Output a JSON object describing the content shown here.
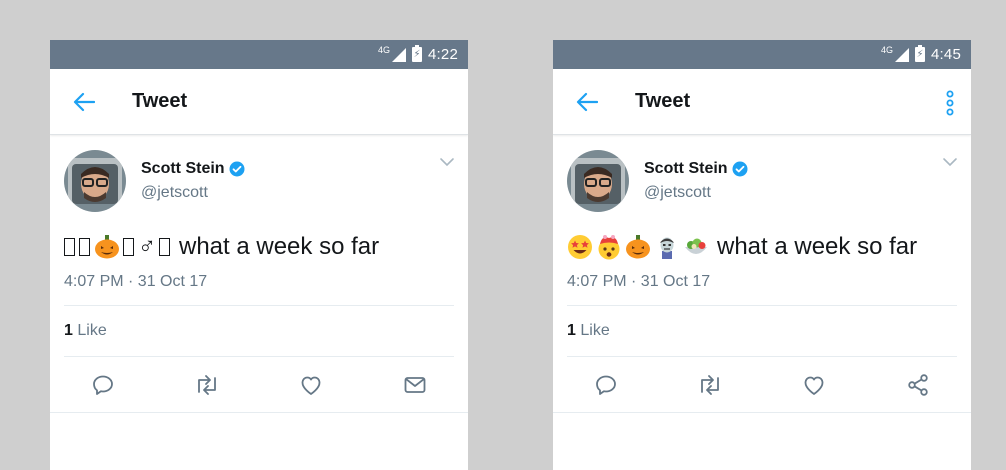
{
  "left": {
    "status_bar": {
      "network": "4G",
      "time": "4:22"
    },
    "app_bar": {
      "title": "Tweet"
    },
    "tweet": {
      "display_name": "Scott Stein",
      "handle": "@jetscott",
      "text": "what a week so far",
      "emoji_fallback": "♂",
      "timestamp": "4:07 PM · 31 Oct 17",
      "like_count": "1",
      "like_label": "Like"
    },
    "actions": [
      "reply-icon",
      "retweet-icon",
      "like-icon",
      "message-icon"
    ]
  },
  "right": {
    "status_bar": {
      "network": "4G",
      "time": "4:45"
    },
    "app_bar": {
      "title": "Tweet"
    },
    "tweet": {
      "display_name": "Scott Stein",
      "handle": "@jetscott",
      "text": "what a week so far",
      "timestamp": "4:07 PM · 31 Oct 17",
      "like_count": "1",
      "like_label": "Like"
    },
    "actions": [
      "reply-icon",
      "retweet-icon",
      "like-icon",
      "share-icon"
    ]
  },
  "colors": {
    "accent": "#1da1f2",
    "status_bar": "#67788a",
    "text_primary": "#14171a",
    "text_secondary": "#657786",
    "background": "#cfcfcf"
  }
}
